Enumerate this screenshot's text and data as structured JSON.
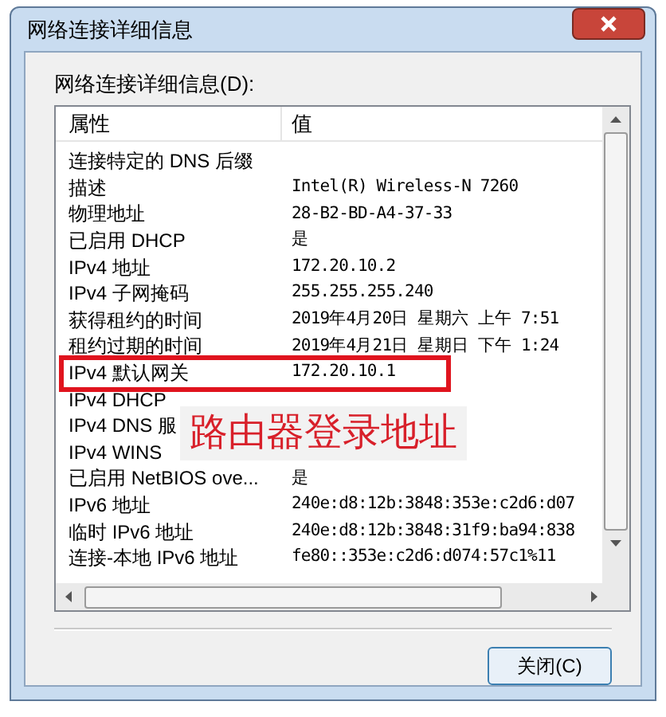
{
  "window": {
    "title": "网络连接详细信息"
  },
  "group_label": "网络连接详细信息(D):",
  "table": {
    "columns": [
      "属性",
      "值"
    ],
    "rows": [
      {
        "property": "连接特定的 DNS 后缀"
      },
      {
        "property": "描述",
        "value": "Intel(R) Wireless-N 7260"
      },
      {
        "property": "物理地址",
        "value": "28-B2-BD-A4-37-33"
      },
      {
        "property": "已启用 DHCP",
        "value": "是"
      },
      {
        "property": "IPv4 地址",
        "value": "172.20.10.2"
      },
      {
        "property": "IPv4 子网掩码",
        "value": "255.255.255.240"
      },
      {
        "property": "获得租约的时间",
        "value": "2019年4月20日 星期六 上午 7:51"
      },
      {
        "property": "租约过期的时间",
        "value": "2019年4月21日 星期日 下午 1:24"
      },
      {
        "property": "IPv4 默认网关",
        "value": "172.20.10.1",
        "highlighted": true
      },
      {
        "property": "IPv4 DHCP"
      },
      {
        "property": "IPv4 DNS 服"
      },
      {
        "property": "IPv4 WINS"
      },
      {
        "property": "已启用 NetBIOS ove...",
        "value": "是"
      },
      {
        "property": "IPv6 地址",
        "value": "240e:d8:12b:3848:353e:c2d6:d07"
      },
      {
        "property": "临时 IPv6 地址",
        "value": "240e:d8:12b:3848:31f9:ba94:838"
      },
      {
        "property": "连接-本地 IPv6 地址",
        "value": "fe80::353e:c2d6:d074:57c1%11"
      }
    ]
  },
  "annotation": "路由器登录地址",
  "buttons": [
    "关闭(C)"
  ]
}
